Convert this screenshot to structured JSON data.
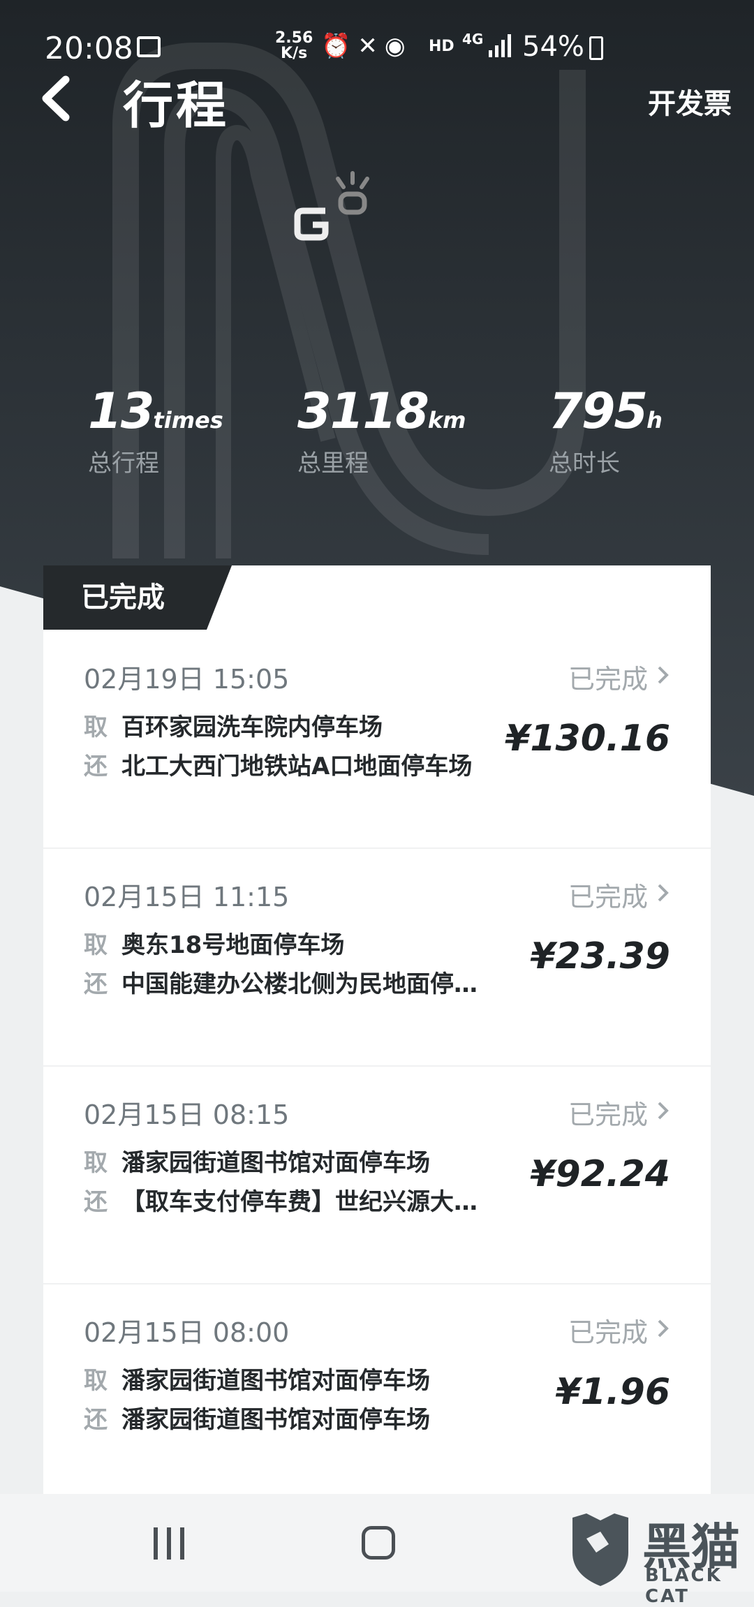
{
  "status_bar": {
    "time": "20:08",
    "speed": "2.56",
    "speed_unit": "K/s",
    "hd": "HD",
    "network": "4G",
    "battery": "54%"
  },
  "header": {
    "title": "行程",
    "invoice": "开发票"
  },
  "stats": [
    {
      "value": "13",
      "unit": "times",
      "label": "总行程"
    },
    {
      "value": "3118",
      "unit": "km",
      "label": "总里程"
    },
    {
      "value": "795",
      "unit": "h",
      "label": "总时长"
    }
  ],
  "tab": "已完成",
  "pickup_tag": "取",
  "return_tag": "还",
  "trips": [
    {
      "date": "02月19日 15:05",
      "status": "已完成",
      "pickup": "百环家园洗车院内停车场",
      "return": "北工大西门地铁站A口地面停车场",
      "price": "¥130.16"
    },
    {
      "date": "02月15日 11:15",
      "status": "已完成",
      "pickup": "奥东18号地面停车场",
      "return": "中国能建办公楼北侧为民地面停…",
      "price": "¥23.39"
    },
    {
      "date": "02月15日 08:15",
      "status": "已完成",
      "pickup": "潘家园街道图书馆对面停车场",
      "return": "【取车支付停车费】世纪兴源大…",
      "price": "¥92.24"
    },
    {
      "date": "02月15日 08:00",
      "status": "已完成",
      "pickup": "潘家园街道图书馆对面停车场",
      "return": "潘家园街道图书馆对面停车场",
      "price": "¥1.96"
    }
  ],
  "watermark": {
    "cn": "黑猫",
    "en": "BLACK CAT"
  }
}
